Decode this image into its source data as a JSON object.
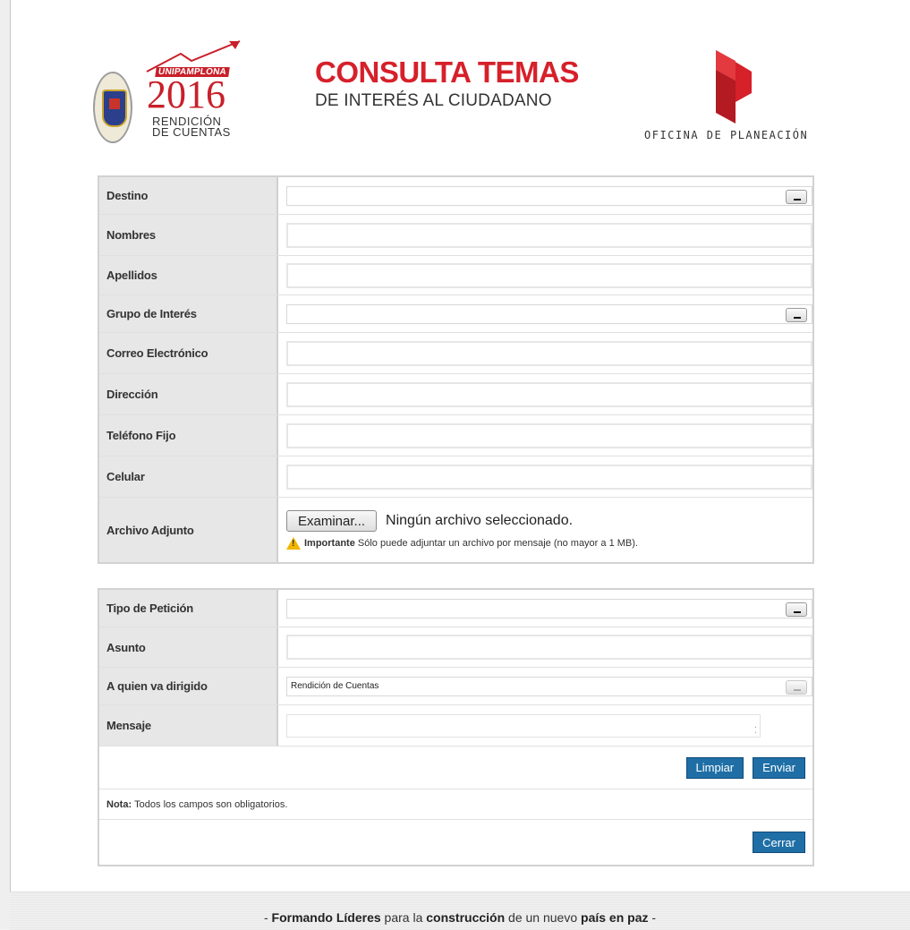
{
  "header": {
    "uni_banner": "UNIPAMPLONA",
    "uni_year": "2016",
    "uni_sub_line1": "RENDICIÓN",
    "uni_sub_line2": "DE CUENTAS",
    "title": "CONSULTA TEMAS",
    "subtitle": "DE INTERÉS AL CIUDADANO",
    "office": "OFICINA DE PLANEACIÓN"
  },
  "form1": {
    "destino_label": "Destino",
    "destino_value": "",
    "nombres_label": "Nombres",
    "apellidos_label": "Apellidos",
    "grupo_label": "Grupo de Interés",
    "grupo_value": "",
    "correo_label": "Correo Electrónico",
    "direccion_label": "Dirección",
    "telefono_label": "Teléfono Fijo",
    "celular_label": "Celular",
    "archivo_label": "Archivo Adjunto",
    "file_button": "Examinar...",
    "file_status": "Ningún archivo seleccionado.",
    "warn_bold": "Importante",
    "warn_text": "Sólo puede adjuntar un archivo por mensaje (no mayor a 1 MB)."
  },
  "form2": {
    "tipo_label": "Tipo de Petición",
    "tipo_value": "",
    "asunto_label": "Asunto",
    "dirigido_label": "A quien va dirigido",
    "dirigido_value": "Rendición de Cuentas",
    "mensaje_label": "Mensaje",
    "limpiar": "Limpiar",
    "enviar": "Enviar",
    "nota_bold": "Nota:",
    "nota_text": "Todos los campos son obligatorios.",
    "cerrar": "Cerrar"
  },
  "footer": {
    "p1": "- ",
    "b1": "Formando Líderes",
    "p2": " para la ",
    "b2": "construcción",
    "p3": " de un nuevo ",
    "b3": "país en paz",
    "p4": " -"
  },
  "colors": {
    "brand_red": "#d6202a",
    "button_blue": "#1f6fa6"
  }
}
